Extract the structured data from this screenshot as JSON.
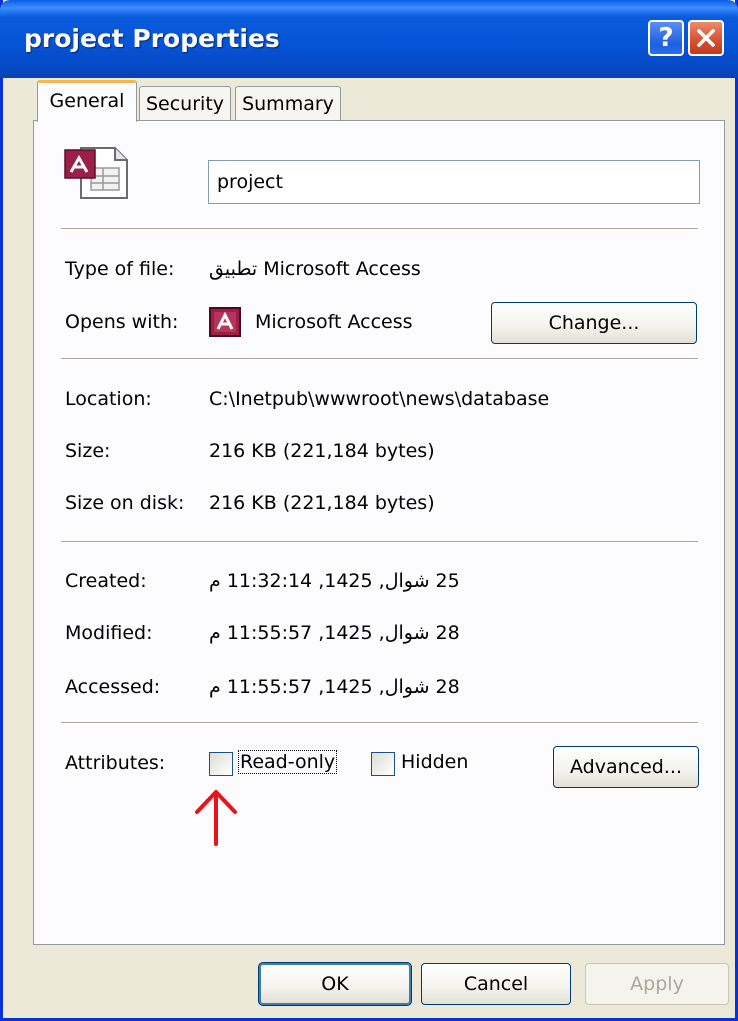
{
  "window": {
    "title": "project Properties",
    "help_label": "?",
    "colors": {
      "titlebar": "#0553d6",
      "face": "#ece9d8",
      "close": "#d4502e",
      "accent_tab": "#f7b54f"
    }
  },
  "tabs": [
    {
      "label": "General",
      "selected": true
    },
    {
      "label": "Security",
      "selected": false
    },
    {
      "label": "Summary",
      "selected": false
    }
  ],
  "file": {
    "name": "project",
    "icon": "access-database-icon"
  },
  "fields": {
    "type_label": "Type of file:",
    "type_value": "تطبيق Microsoft Access",
    "opens_label": "Opens with:",
    "opens_value": "Microsoft Access",
    "opens_icon": "access-app-icon",
    "change_button": "Change...",
    "location_label": "Location:",
    "location_value": "C:\\Inetpub\\wwwroot\\news\\database",
    "size_label": "Size:",
    "size_value": "216 KB (221,184 bytes)",
    "size_on_disk_label": "Size on disk:",
    "size_on_disk_value": "216 KB (221,184 bytes)",
    "created_label": "Created:",
    "created_value": "25 شوال, 1425, 11:32:14 م",
    "modified_label": "Modified:",
    "modified_value": "28 شوال, 1425, 11:55:57 م",
    "accessed_label": "Accessed:",
    "accessed_value": "28 شوال, 1425, 11:55:57 م"
  },
  "attributes": {
    "label": "Attributes:",
    "readonly_label": "Read-only",
    "readonly_checked": false,
    "hidden_label": "Hidden",
    "hidden_checked": false,
    "advanced_button": "Advanced...",
    "annotation": {
      "icon": "red-up-arrow-icon",
      "color": "#e8141b"
    }
  },
  "footer": {
    "ok": "OK",
    "cancel": "Cancel",
    "apply": "Apply",
    "apply_enabled": false
  }
}
